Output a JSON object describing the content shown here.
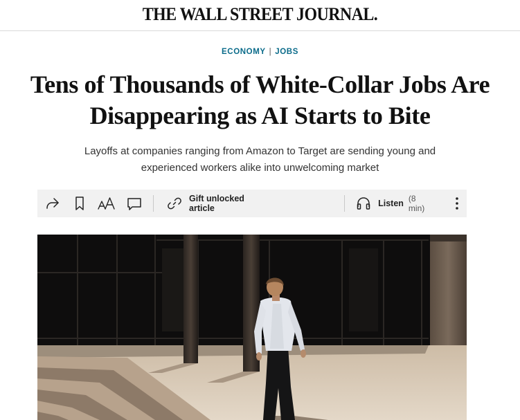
{
  "masthead": {
    "title": "THE WALL STREET JOURNAL."
  },
  "sections": [
    {
      "label": "ECONOMY"
    },
    {
      "label": "JOBS"
    }
  ],
  "sections_separator": "|",
  "headline": "Tens of Thousands of White-Collar Jobs Are Disappearing as AI Starts to Bite",
  "dek": "Layoffs at companies ranging from Amazon to Target are sending young and experienced workers alike into unwelcoming market",
  "toolbar": {
    "share_icon": "share-arrow-icon",
    "save_icon": "bookmark-icon",
    "text_size_icon": "text-size-icon",
    "comments_icon": "comment-icon",
    "gift_icon": "link-icon",
    "gift_label": "Gift unlocked article",
    "listen_icon": "headphones-icon",
    "listen_label": "Listen",
    "listen_duration": "(8 min)",
    "more_icon": "more-vertical-icon"
  },
  "colors": {
    "section_link": "#0a6b8a",
    "toolbar_bg": "#f1f1f1"
  }
}
